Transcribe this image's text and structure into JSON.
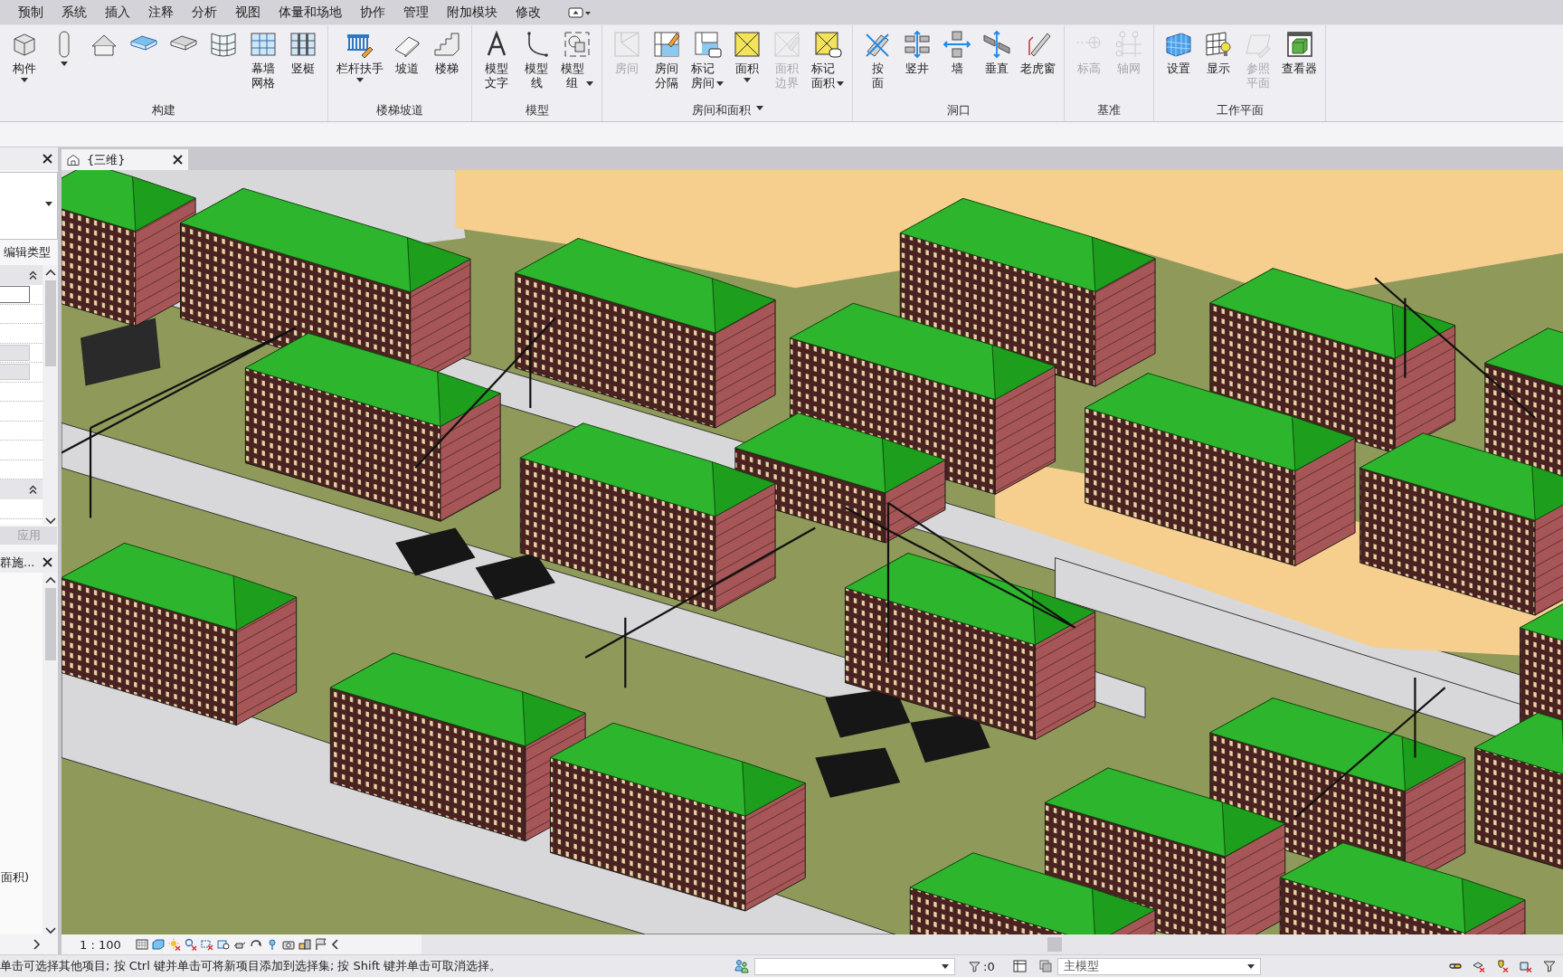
{
  "menu_tabs": [
    {
      "label": "预制",
      "selected": false
    },
    {
      "label": "系统",
      "selected": false
    },
    {
      "label": "插入",
      "selected": false
    },
    {
      "label": "注释",
      "selected": false
    },
    {
      "label": "分析",
      "selected": false
    },
    {
      "label": "视图",
      "selected": false
    },
    {
      "label": "体量和场地",
      "selected": false
    },
    {
      "label": "协作",
      "selected": false
    },
    {
      "label": "管理",
      "selected": false
    },
    {
      "label": "附加模块",
      "selected": false
    },
    {
      "label": "修改",
      "selected": false
    }
  ],
  "ribbon": {
    "groups": [
      {
        "title": "构建",
        "dropdown": false,
        "items": [
          {
            "label": "构件",
            "dropdown": true,
            "disabled": false
          },
          {
            "dropdown": true,
            "disabled": false
          },
          {
            "dropdown": false,
            "disabled": false
          },
          {
            "dropdown": false,
            "disabled": false
          },
          {
            "dropdown": false,
            "disabled": false
          },
          {
            "dropdown": false,
            "disabled": false
          },
          {
            "label": "幕墙网格",
            "dropdown": false,
            "disabled": false
          },
          {
            "label": "竖梃",
            "dropdown": false,
            "disabled": false
          }
        ]
      },
      {
        "title": "楼梯坡道",
        "dropdown": false,
        "items": [
          {
            "label": "栏杆扶手",
            "dropdown": true,
            "disabled": false
          },
          {
            "label": "坡道",
            "dropdown": false,
            "disabled": false
          },
          {
            "label": "楼梯",
            "dropdown": false,
            "disabled": false
          }
        ]
      },
      {
        "title": "模型",
        "dropdown": false,
        "items": [
          {
            "label": "模型文字",
            "dropdown": false,
            "disabled": false
          },
          {
            "label": "模型线",
            "dropdown": false,
            "disabled": false
          },
          {
            "label": "模型组",
            "dropdown": true,
            "disabled": false
          }
        ]
      },
      {
        "title": "房间和面积",
        "dropdown": true,
        "items": [
          {
            "label": "房间",
            "dropdown": false,
            "disabled": true
          },
          {
            "label": "房间分隔",
            "dropdown": false,
            "disabled": false
          },
          {
            "label": "标记房间",
            "dropdown": true,
            "disabled": false
          },
          {
            "label": "面积",
            "dropdown": true,
            "disabled": false
          },
          {
            "label": "面积边界",
            "dropdown": false,
            "disabled": true
          },
          {
            "label": "标记面积",
            "dropdown": true,
            "disabled": false
          }
        ]
      },
      {
        "title": "洞口",
        "dropdown": false,
        "items": [
          {
            "label": "按面",
            "dropdown": false,
            "disabled": false
          },
          {
            "label": "竖井",
            "dropdown": false,
            "disabled": false
          },
          {
            "label": "墙",
            "dropdown": false,
            "disabled": false
          },
          {
            "label": "垂直",
            "dropdown": false,
            "disabled": false
          },
          {
            "label": "老虎窗",
            "dropdown": false,
            "disabled": false
          }
        ]
      },
      {
        "title": "基准",
        "dropdown": false,
        "items": [
          {
            "label": "标高",
            "dropdown": false,
            "disabled": true
          },
          {
            "label": "轴网",
            "dropdown": false,
            "disabled": true
          }
        ]
      },
      {
        "title": "工作平面",
        "dropdown": false,
        "items": [
          {
            "label": "设置",
            "dropdown": false,
            "disabled": false
          },
          {
            "label": "显示",
            "dropdown": false,
            "disabled": false
          },
          {
            "label": "参照平面",
            "dropdown": false,
            "disabled": true
          },
          {
            "label": "查看器",
            "dropdown": false,
            "disabled": false
          }
        ]
      }
    ]
  },
  "properties": {
    "edit_type": "编辑类型",
    "apply": {
      "label": "应用",
      "disabled": true
    }
  },
  "project_browser": {
    "title": "群施...",
    "items": [
      {
        "label": "面积)"
      }
    ]
  },
  "view_tabs": [
    {
      "title": "{三维}",
      "selected": true
    }
  ],
  "view_control_bar": {
    "scale": "1 : 100"
  },
  "status_bar": {
    "message": "单击可选择其他项目; 按 Ctrl 键并单击可将新项目添加到选择集; 按 Shift 键并单击可取消选择。",
    "filter_count": ":0",
    "active_model": "主模型"
  }
}
